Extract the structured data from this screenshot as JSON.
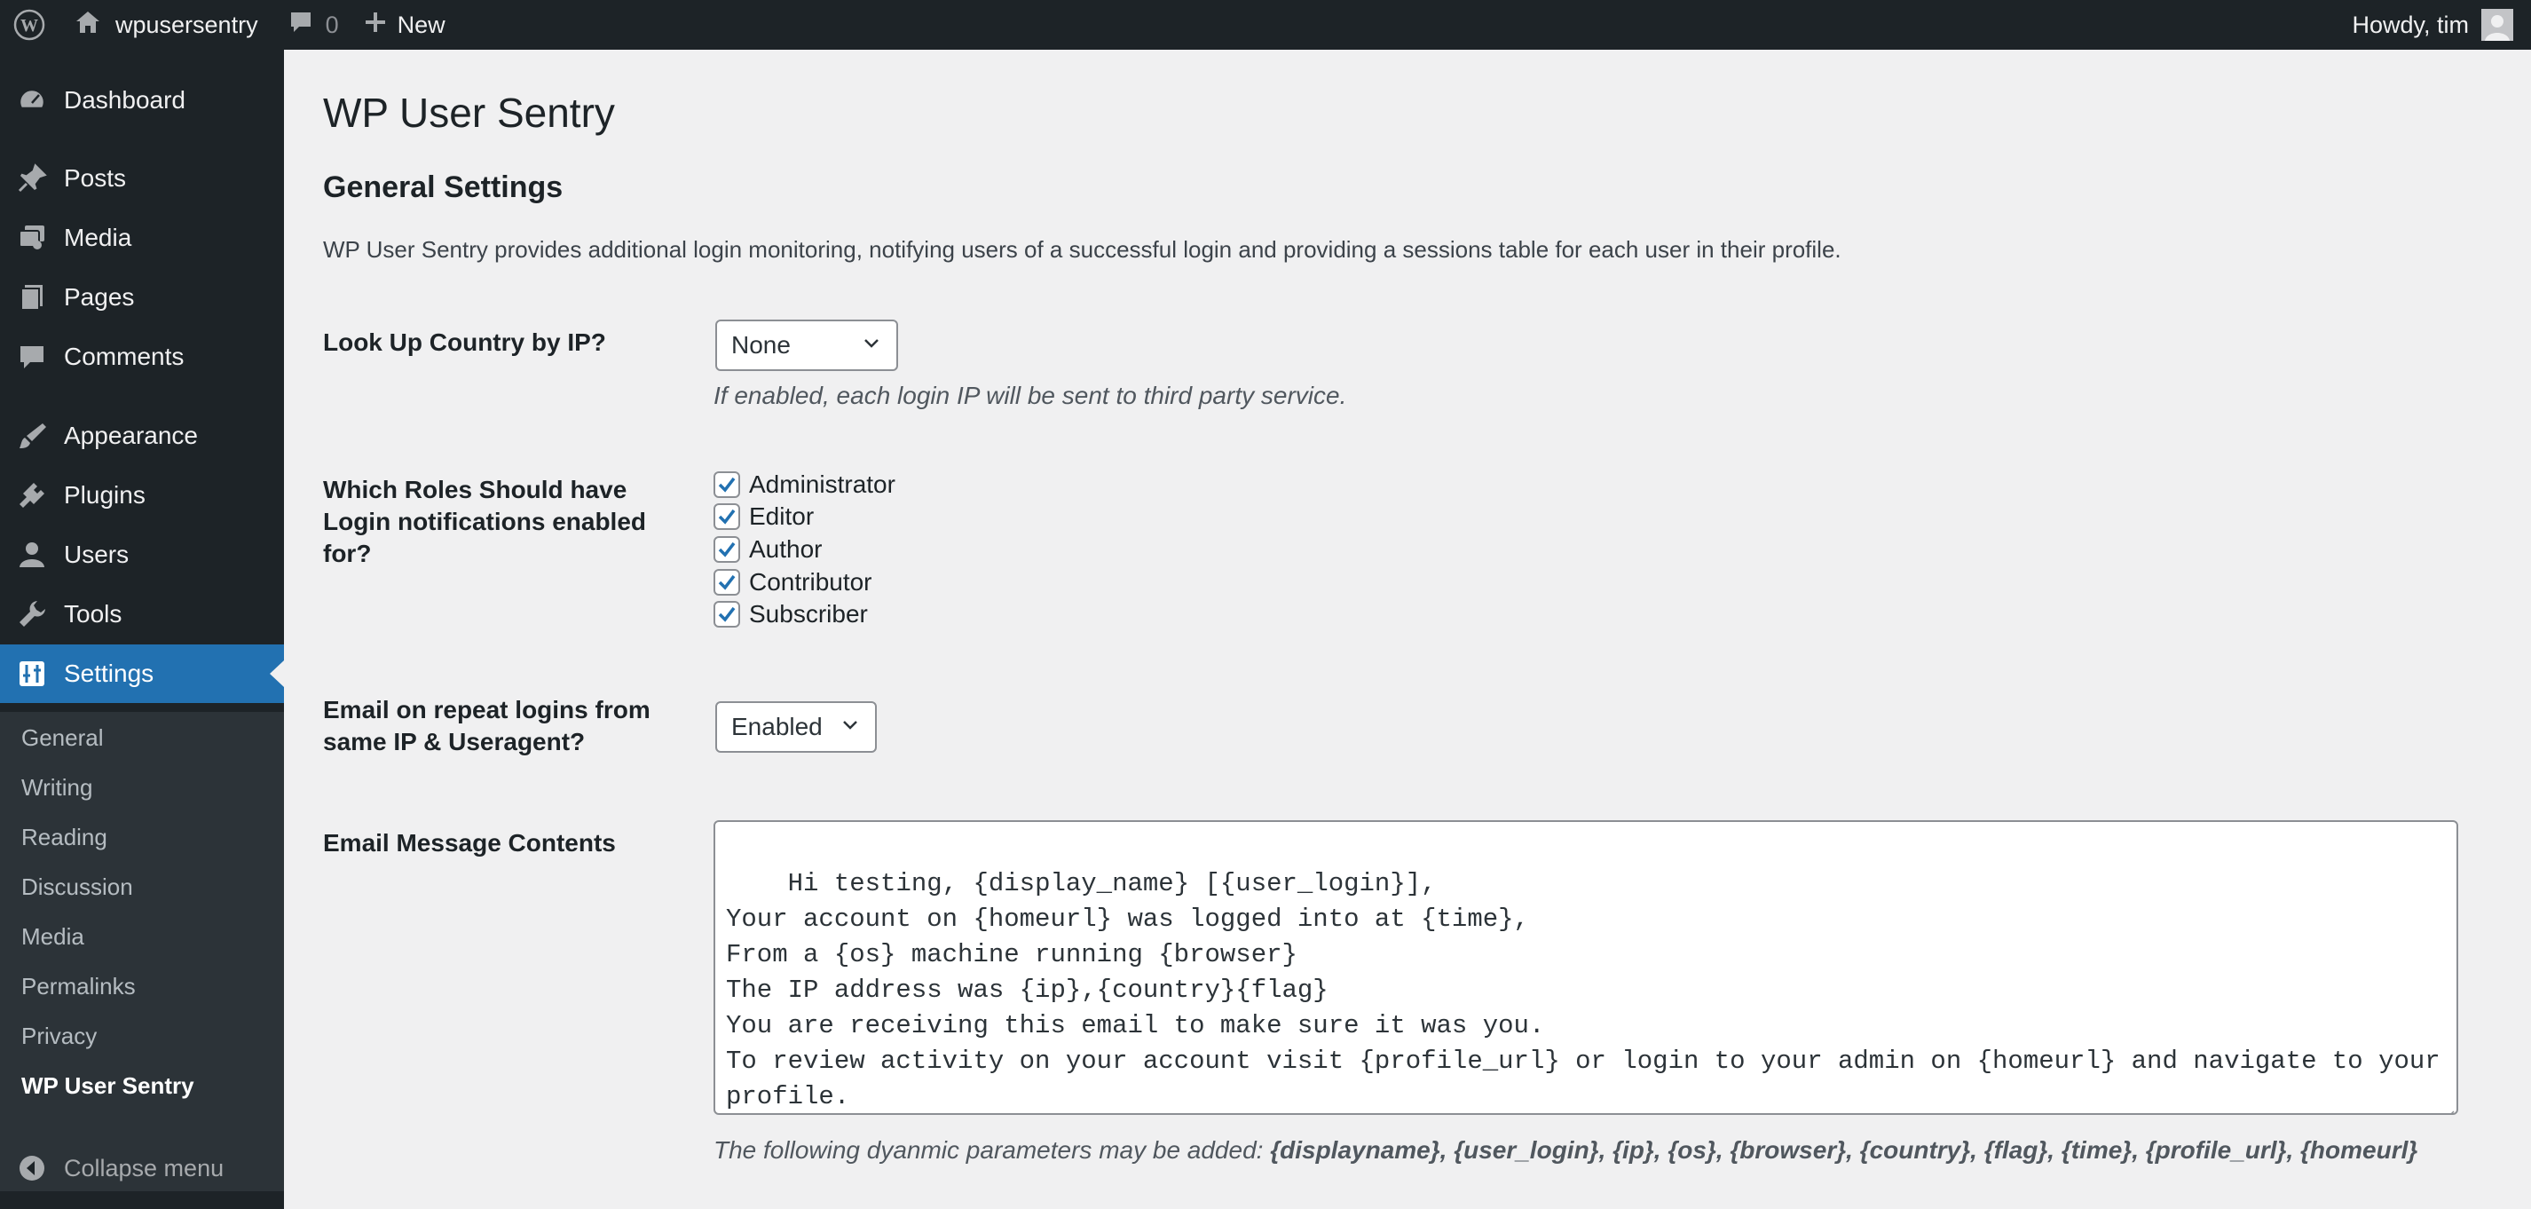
{
  "admin_bar": {
    "site_name": "wpusersentry",
    "comments_count": "0",
    "new_label": "New",
    "greeting": "Howdy, tim"
  },
  "sidebar": {
    "items": [
      {
        "label": "Dashboard",
        "icon": "dashboard-icon"
      },
      {
        "label": "Posts",
        "icon": "pin-icon"
      },
      {
        "label": "Media",
        "icon": "media-icon"
      },
      {
        "label": "Pages",
        "icon": "pages-icon"
      },
      {
        "label": "Comments",
        "icon": "comment-icon"
      },
      {
        "label": "Appearance",
        "icon": "brush-icon"
      },
      {
        "label": "Plugins",
        "icon": "plugin-icon"
      },
      {
        "label": "Users",
        "icon": "user-icon"
      },
      {
        "label": "Tools",
        "icon": "wrench-icon"
      },
      {
        "label": "Settings",
        "icon": "settings-icon",
        "current": true
      }
    ],
    "submenu": [
      "General",
      "Writing",
      "Reading",
      "Discussion",
      "Media",
      "Permalinks",
      "Privacy",
      "WP User Sentry"
    ],
    "collapse_label": "Collapse menu"
  },
  "page": {
    "title": "WP User Sentry",
    "section_title": "General Settings",
    "description": "WP User Sentry provides additional login monitoring, notifying users of a successful login and providing a sessions table for each user in their profile."
  },
  "settings": {
    "country_lookup": {
      "label": "Look Up Country by IP?",
      "selected": "None",
      "hint": "If enabled, each login IP will be sent to third party service."
    },
    "roles": {
      "label_lines": [
        "Which Roles Should have",
        "Login notifications enabled",
        "for?"
      ],
      "options": [
        {
          "label": "Administrator",
          "checked": true
        },
        {
          "label": "Editor",
          "checked": true
        },
        {
          "label": "Author",
          "checked": true
        },
        {
          "label": "Contributor",
          "checked": true
        },
        {
          "label": "Subscriber",
          "checked": true
        }
      ]
    },
    "repeat_logins": {
      "label_lines": [
        "Email on repeat logins from",
        "same IP & Useragent?"
      ],
      "selected": "Enabled"
    },
    "email_message": {
      "label": "Email Message Contents",
      "content": "Hi testing, {display_name} [{user_login}],\nYour account on {homeurl} was logged into at {time},\nFrom a {os} machine running {browser}\nThe IP address was {ip},{country}{flag}\nYou are receiving this email to make sure it was you.\nTo review activity on your account visit {profile_url} or login to your admin on {homeurl} and navigate to your\nprofile.",
      "params_prefix": "The following dyanmic parameters may be added: ",
      "params": "{displayname}, {user_login}, {ip}, {os}, {browser}, {country}, {flag}, {time}, {profile_url}, {homeurl}"
    }
  },
  "colors": {
    "admin_bar_bg": "#1d2327",
    "sidebar_bg": "#1d2327",
    "submenu_bg": "#2c3338",
    "accent": "#2271b1",
    "page_bg": "#f0f0f1"
  }
}
